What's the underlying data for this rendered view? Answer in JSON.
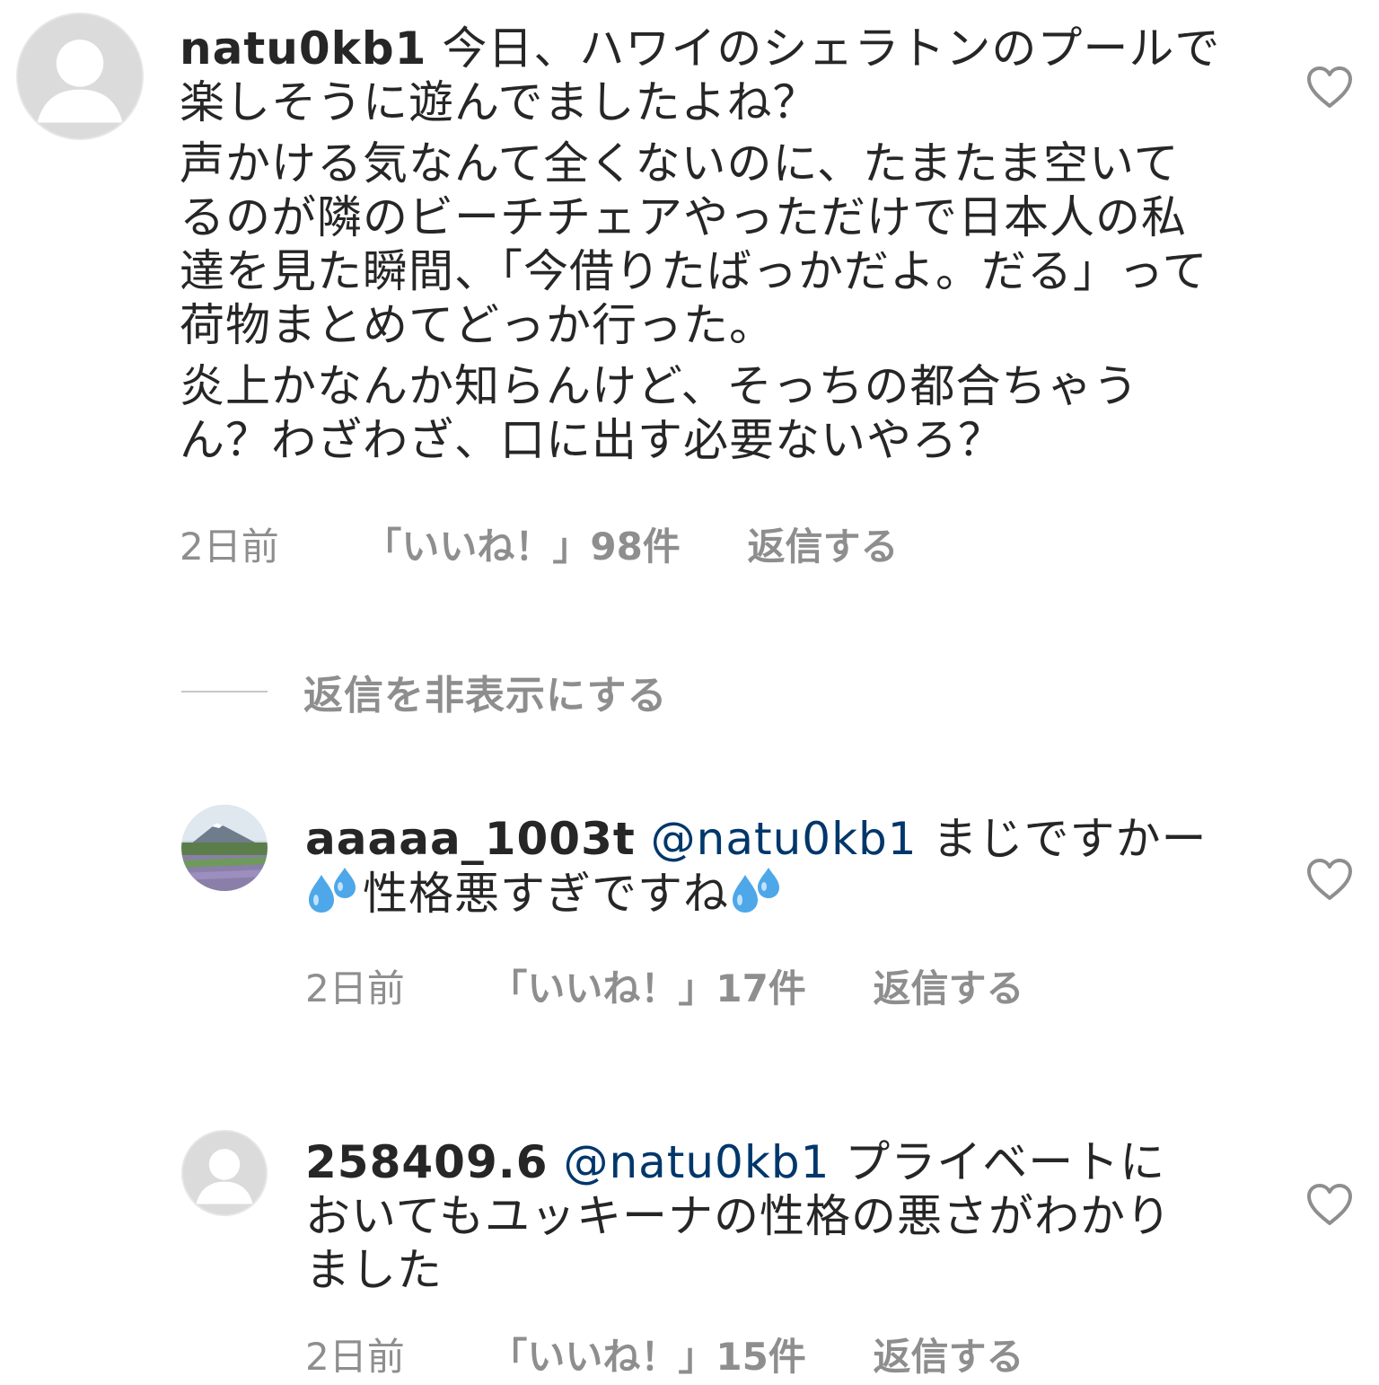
{
  "comments": [
    {
      "username": "natu0kb1",
      "lines": [
        "今日、ハワイのシェラトンのプールで楽しそうに遊んでましたよね？",
        "声かける気なんて全くないのに、たまたま空いてるのが隣のビーチチェアやっただけで日本人の私達を見た瞬間、「今借りたばっかだよ。だる」って荷物まとめてどっか行った。",
        "炎上かなんか知らんけど、そっちの都合ちゃうん？わざわざ、口に出す必要ないやろ？"
      ],
      "time": "2日前",
      "likes": "「いいね！」98件",
      "reply": "返信する",
      "avatar_icon": "default-avatar-icon",
      "like_icon": "heart-outline-icon"
    },
    {
      "username": "aaaaa_1003t",
      "mention": "@natu0kb1",
      "text_before": "まじですかー",
      "text_middle": "性格悪すぎですね",
      "emoji": "sweat-droplets-emoji",
      "time": "2日前",
      "likes": "「いいね！」17件",
      "reply": "返信する",
      "avatar_icon": "landscape-photo-avatar",
      "like_icon": "heart-outline-icon"
    },
    {
      "username": "258409.6",
      "mention": "@natu0kb1",
      "text": "プライベートにおいてもユッキーナの性格の悪さがわかりました",
      "time": "2日前",
      "likes": "「いいね！」15件",
      "reply": "返信する",
      "avatar_icon": "default-avatar-icon",
      "like_icon": "heart-outline-icon"
    }
  ],
  "replies_toggle": {
    "label": "返信を非表示にする"
  },
  "colors": {
    "text": "#262626",
    "secondary": "#8e8e8e",
    "mention": "#00376b",
    "divider": "#c7c7c7",
    "avatar_bg": "#dbdbdb"
  }
}
